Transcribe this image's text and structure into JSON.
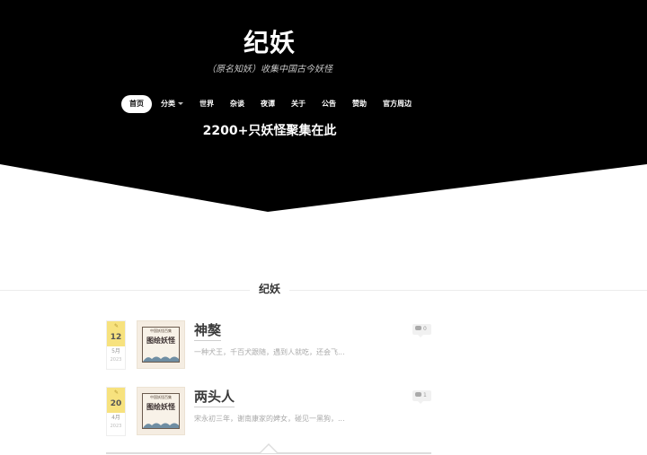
{
  "header": {
    "site_title": "纪妖",
    "subtitle": "（原名知妖）收集中国古今妖怪",
    "tagline": "2200+只妖怪聚集在此",
    "background": "#000000"
  },
  "nav": {
    "items": [
      {
        "label": "首页",
        "active": true
      },
      {
        "label": "分类",
        "dropdown": true
      },
      {
        "label": "世界"
      },
      {
        "label": "杂谈"
      },
      {
        "label": "夜谭"
      },
      {
        "label": "关于"
      },
      {
        "label": "公告"
      },
      {
        "label": "赞助"
      },
      {
        "label": "官方周边"
      }
    ]
  },
  "section": {
    "title": "纪妖"
  },
  "posts": [
    {
      "day": "12",
      "month": "5月",
      "year": "2023",
      "title": "神獒",
      "excerpt": "一种犬王，千百犬跟随，遇到人就吃，还会飞...",
      "comments": "0",
      "thumb_head": "中国妖怪百集",
      "thumb_text": "图绘妖怪"
    },
    {
      "day": "20",
      "month": "4月",
      "year": "2023",
      "title": "两头人",
      "excerpt": "宋永初三年，谢南康家的婢女，碰见一黑狗，...",
      "comments": "1",
      "thumb_head": "中国妖怪百集",
      "thumb_text": "图绘妖怪"
    }
  ]
}
